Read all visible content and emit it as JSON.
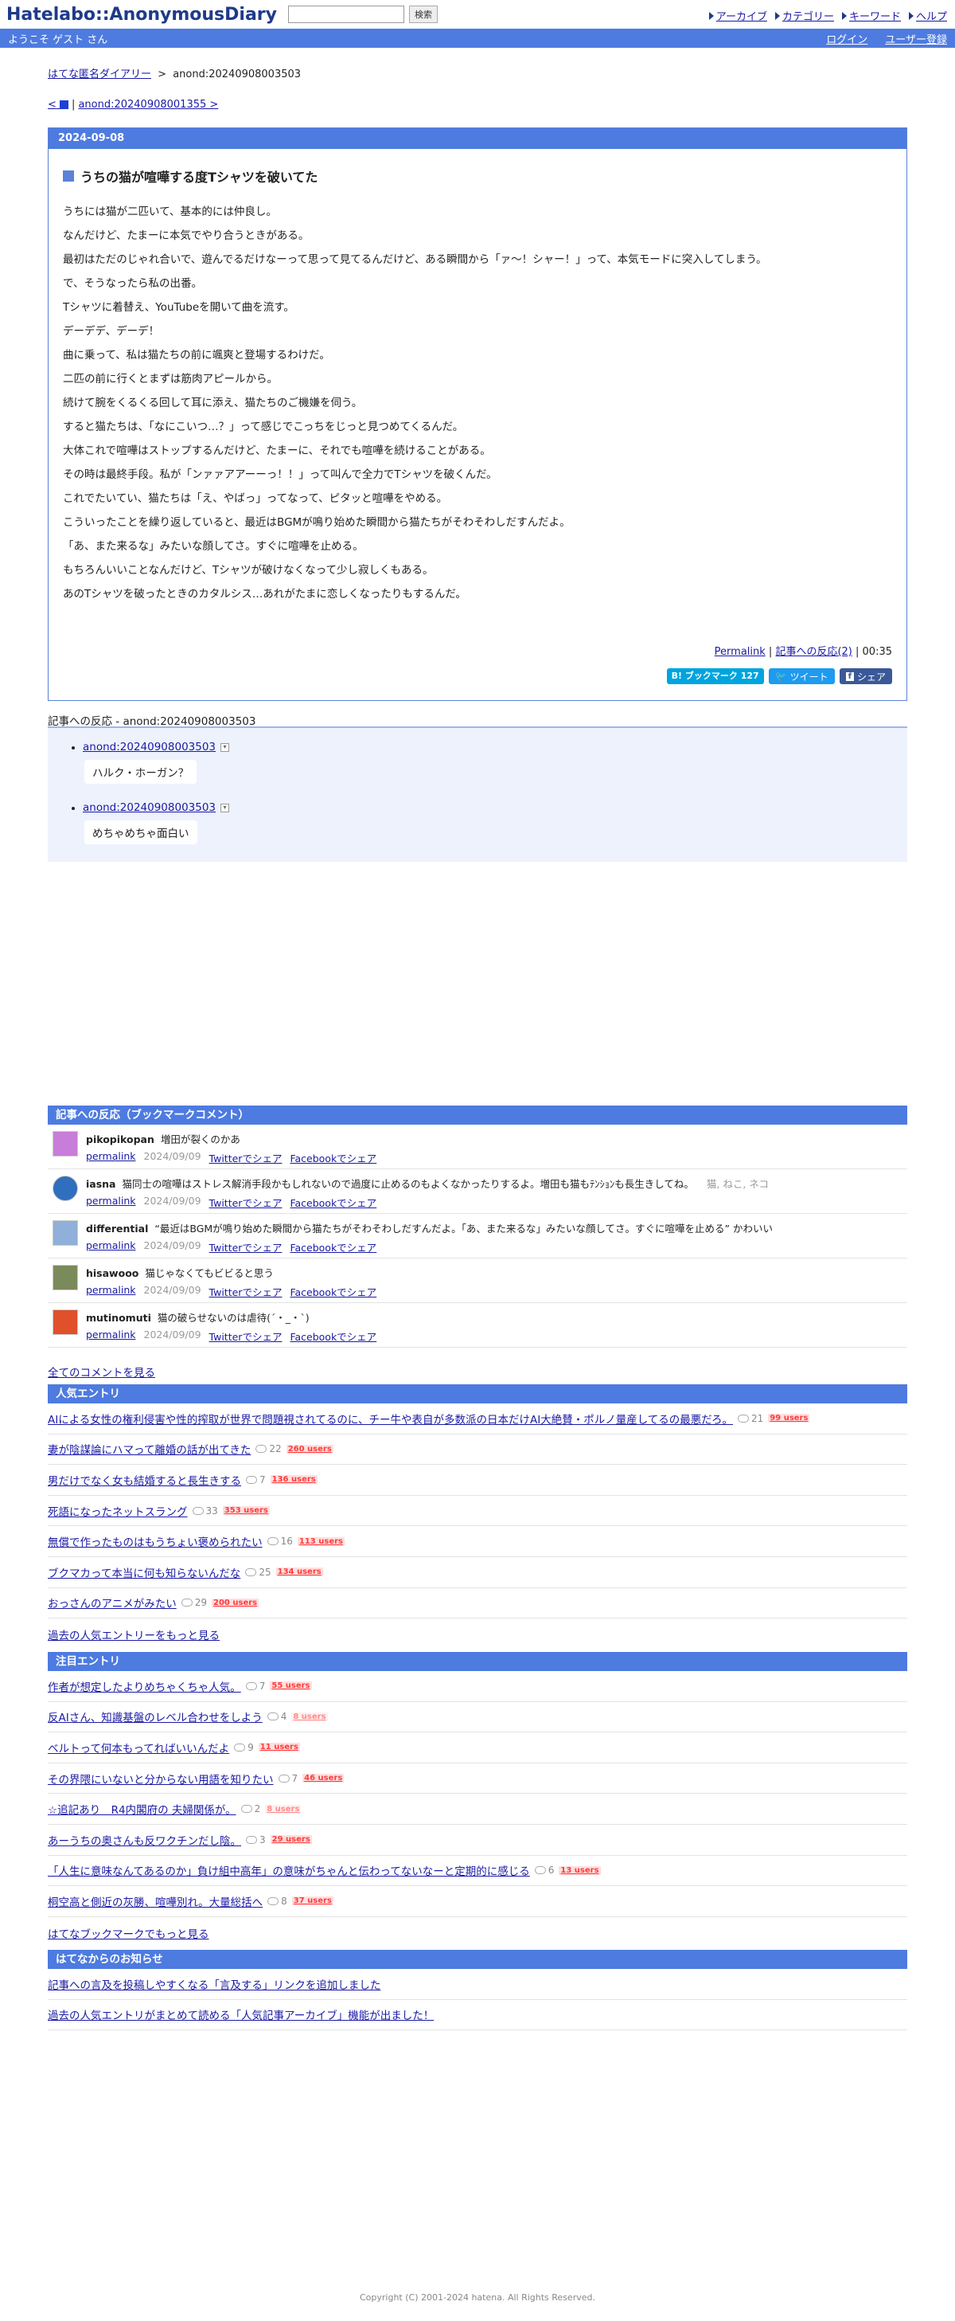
{
  "header": {
    "logo": "Hatelabo::AnonymousDiary",
    "search_placeholder": "",
    "search_button": "検索",
    "nav": [
      "アーカイブ",
      "カテゴリー",
      "キーワード",
      "ヘルプ"
    ]
  },
  "welcome": {
    "text": "ようこそ ゲスト さん",
    "login": "ログイン",
    "register": "ユーザー登録"
  },
  "breadcrumb": {
    "home": "はてな匿名ダイアリー",
    "sep": ">",
    "current": "anond:20240908003503"
  },
  "article_nav": {
    "prev": "<",
    "sep": "|",
    "next": "anond:20240908001355 >"
  },
  "article": {
    "date": "2024-09-08",
    "title": "うちの猫が喧嘩する度Tシャツを破いてた",
    "paragraphs": [
      "うちには猫が二匹いて、基本的には仲良し。",
      "なんだけど、たまーに本気でやり合うときがある。",
      "最初はただのじゃれ合いで、遊んでるだけなーって思って見てるんだけど、ある瞬間から「ァ〜！シャー！」って、本気モードに突入してしまう。",
      "で、そうなったら私の出番。",
      "Tシャツに着替え、YouTubeを開いて曲を流す。",
      "デーデデ、デーデ！",
      "曲に乗って、私は猫たちの前に颯爽と登場するわけだ。",
      "二匹の前に行くとまずは筋肉アピールから。",
      "続けて腕をくるくる回して耳に添え、猫たちのご機嫌を伺う。",
      "すると猫たちは、「なにこいつ…？」って感じでこっちをじっと見つめてくるんだ。",
      "大体これで喧嘩はストップするんだけど、たまーに、それでも喧嘩を続けることがある。",
      "その時は最終手段。私が「ンァァアアーーっ！！」って叫んで全力でTシャツを破くんだ。",
      "これでたいてい、猫たちは「え、やばっ」ってなって、ピタッと喧嘩をやめる。",
      "こういったことを繰り返していると、最近はBGMが鳴り始めた瞬間から猫たちがそわそわしだすんだよ。",
      "「あ、また来るな」みたいな顔してさ。すぐに喧嘩を止める。",
      "もちろんいいことなんだけど、Tシャツが破けなくなって少し寂しくもある。",
      "あのTシャツを破ったときのカタルシス…あれがたまに恋しくなったりもするんだ。"
    ],
    "permalink": "Permalink",
    "reactions_link": "記事への反応(2)",
    "time": "00:35",
    "bookmark_label": "B! ブックマーク",
    "bookmark_count": "127",
    "tweet": "ツイート",
    "share": "シェア"
  },
  "reactions": {
    "label": "記事への反応 - anond:20240908003503",
    "items": [
      {
        "link": "anond:20240908003503",
        "text": "ハルク・ホーガン？"
      },
      {
        "link": "anond:20240908003503",
        "text": "めちゃめちゃ面白い"
      }
    ]
  },
  "bookmark_comments": {
    "heading": "記事への反応（ブックマークコメント）",
    "items": [
      {
        "user": "pikopikopan",
        "comment": "増田が裂くのかあ",
        "tags": "",
        "date": "2024/09/09",
        "avatar_color": "#c77dd9"
      },
      {
        "user": "iasna",
        "comment": "猫同士の喧嘩はストレス解消手段かもしれないので過度に止めるのもよくなかったりするよ。増田も猫もﾃﾝｼｮﾝも長生きしてね。",
        "tags": "猫, ねこ, ネコ",
        "date": "2024/09/09",
        "avatar_color": "#2f6fbd"
      },
      {
        "user": "differential",
        "comment": "“最近はBGMが鳴り始めた瞬間から猫たちがそわそわしだすんだよ。「あ、また来るな」みたいな顔してさ。すぐに喧嘩を止める” かわいい",
        "tags": "",
        "date": "2024/09/09",
        "avatar_color": "#8fb0d8"
      },
      {
        "user": "hisawooo",
        "comment": "猫じゃなくてもビビると思う",
        "tags": "",
        "date": "2024/09/09",
        "avatar_color": "#7a8a5a"
      },
      {
        "user": "mutinomuti",
        "comment": "猫の破らせないのは虐待(´・_・`)",
        "tags": "",
        "date": "2024/09/09",
        "avatar_color": "#e0502a"
      }
    ],
    "permalink": "permalink",
    "twitter": "Twitterでシェア",
    "facebook": "Facebookでシェア",
    "all_comments": "全てのコメントを見る"
  },
  "popular": {
    "heading": "人気エントリ",
    "items": [
      {
        "title": "AIによる女性の権利侵害や性的搾取が世界で問題視されてるのに、チー牛や表自が多数派の日本だけAI大絶賛・ポルノ量産してるの最悪だろ。",
        "count": "21",
        "users": "99 users"
      },
      {
        "title": "妻が陰謀論にハマって離婚の話が出てきた",
        "count": "22",
        "users": "260 users"
      },
      {
        "title": "男だけでなく女も結婚すると長生きする",
        "count": "7",
        "users": "136 users"
      },
      {
        "title": "死語になったネットスラング",
        "count": "33",
        "users": "353 users"
      },
      {
        "title": "無償で作ったものはもうちょい褒められたい",
        "count": "16",
        "users": "113 users"
      },
      {
        "title": "ブクマカって本当に何も知らないんだな",
        "count": "25",
        "users": "134 users"
      },
      {
        "title": "おっさんのアニメがみたい",
        "count": "29",
        "users": "200 users"
      }
    ],
    "more": "過去の人気エントリーをもっと見る"
  },
  "attention": {
    "heading": "注目エントリ",
    "items": [
      {
        "title": "作者が想定したよりめちゃくちゃ人気。",
        "count": "7",
        "users": "55 users",
        "light": false
      },
      {
        "title": "反AIさん、知識基盤のレベル合わせをしよう",
        "count": "4",
        "users": "8 users",
        "light": true
      },
      {
        "title": "ベルトって何本もってればいいんだよ",
        "count": "9",
        "users": "11 users",
        "light": false
      },
      {
        "title": "その界隈にいないと分からない用語を知りたい",
        "count": "7",
        "users": "46 users",
        "light": false
      },
      {
        "title": "☆追記あり　R4内閣府の 夫婦関係が。",
        "count": "2",
        "users": "8 users",
        "light": true
      },
      {
        "title": "あーうちの奥さんも反ワクチンだし陰。",
        "count": "3",
        "users": "29 users",
        "light": false
      },
      {
        "title": "「人生に意味なんてあるのか」負け組中高年」の意味がちゃんと伝わってないなーと定期的に感じる",
        "count": "6",
        "users": "13 users",
        "light": false
      },
      {
        "title": "桐空高と側近の灰勝、喧嘩別れ。大量総括へ",
        "count": "8",
        "users": "37 users",
        "light": false
      }
    ],
    "more": "はてなブックマークでもっと見る"
  },
  "notices": {
    "heading": "はてなからのお知らせ",
    "items": [
      "記事への言及を投稿しやすくなる「言及する」リンクを追加しました",
      "過去の人気エントリがまとめて読める「人気記事アーカイブ」機能が出ました！"
    ]
  },
  "footer": {
    "copyright": "Copyright (C) 2001-2024 hatena. All Rights Reserved."
  },
  "colors": {
    "accent": "#4e7be0",
    "logo": "#1e3a8a",
    "reaction_bg": "#eef2fd",
    "users_badge": "#ff3b3b"
  }
}
